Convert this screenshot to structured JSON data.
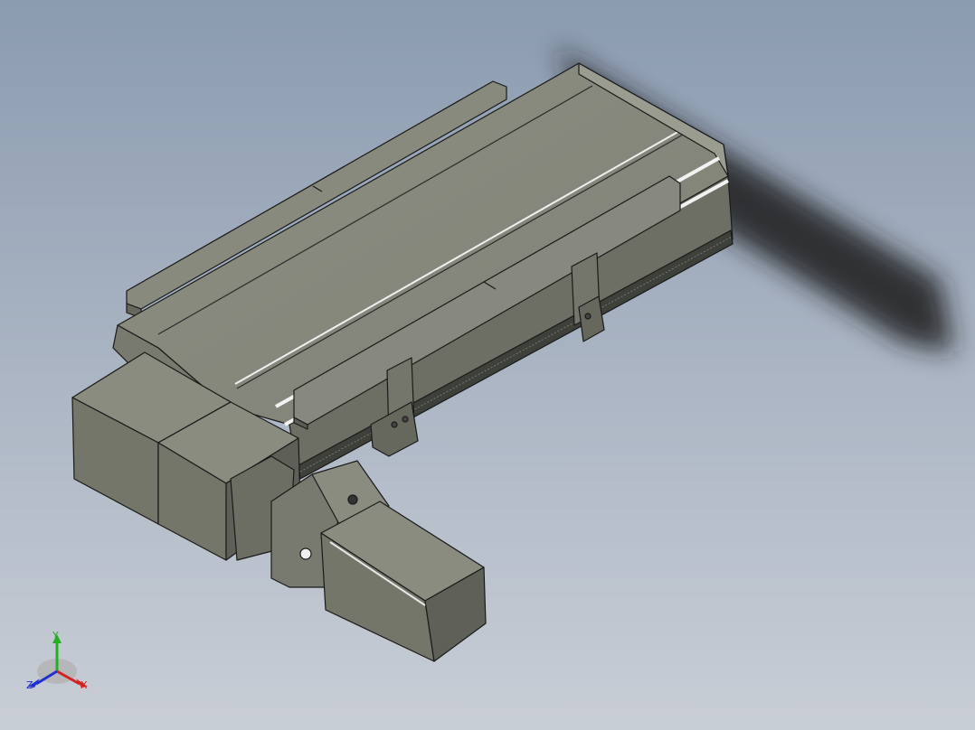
{
  "viewport": {
    "background_top": "#8b9bb0",
    "background_bottom": "#c9ced6",
    "model_colors": {
      "body_top": "#8a8c80",
      "body_side": "#6f7166",
      "body_dark": "#55574e",
      "edge": "#1a1a1a",
      "highlight": "#e8e8e8"
    }
  },
  "triad": {
    "x_label": "X",
    "y_label": "Y",
    "z_label": "Z",
    "x_color": "#d42020",
    "y_color": "#20b020",
    "z_color": "#2030d0"
  }
}
